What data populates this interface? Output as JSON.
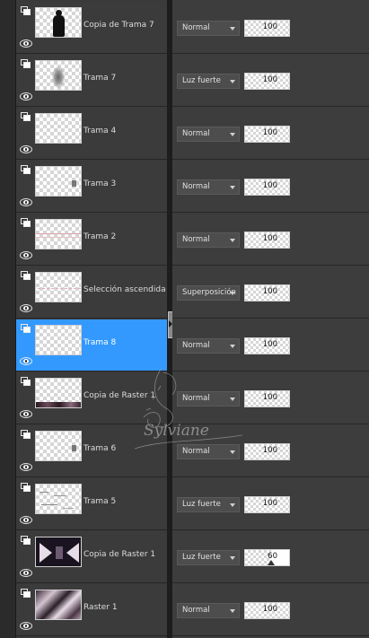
{
  "layers": [
    {
      "name": "Copia de Trama 7",
      "blend": "Normal",
      "opacity": 100,
      "selected": false,
      "thumb": "figure"
    },
    {
      "name": "Trama 7",
      "blend": "Luz fuerte",
      "opacity": 100,
      "selected": false,
      "thumb": "blur"
    },
    {
      "name": "Trama 4",
      "blend": "Normal",
      "opacity": 100,
      "selected": false,
      "thumb": "empty"
    },
    {
      "name": "Trama 3",
      "blend": "Normal",
      "opacity": 100,
      "selected": false,
      "thumb": "small"
    },
    {
      "name": "Trama 2",
      "blend": "Normal",
      "opacity": 100,
      "selected": false,
      "thumb": "lines"
    },
    {
      "name": "Selección ascendida",
      "blend": "Superposición",
      "opacity": 100,
      "selected": false,
      "thumb": "dashes"
    },
    {
      "name": "Trama 8",
      "blend": "Normal",
      "opacity": 100,
      "selected": true,
      "thumb": "empty"
    },
    {
      "name": "Copia de Raster 1",
      "blend": "Normal",
      "opacity": 100,
      "selected": false,
      "thumb": "bottomdark"
    },
    {
      "name": "Trama 6",
      "blend": "Normal",
      "opacity": 100,
      "selected": false,
      "thumb": "small"
    },
    {
      "name": "Trama 5",
      "blend": "Luz fuerte",
      "opacity": 100,
      "selected": false,
      "thumb": "scatter"
    },
    {
      "name": "Copia de Raster 1",
      "blend": "Luz fuerte",
      "opacity": 60,
      "selected": false,
      "thumb": "arrows"
    },
    {
      "name": "Raster 1",
      "blend": "Normal",
      "opacity": 100,
      "selected": false,
      "thumb": "pattern"
    }
  ],
  "watermark": "Sylviane",
  "colors": {
    "selection": "#3399ff",
    "panel": "#3b3b3b"
  },
  "icons": {
    "layer_type": "raster-layer-icon",
    "visibility": "eye-icon",
    "splitter": "chevron-right-icon"
  }
}
